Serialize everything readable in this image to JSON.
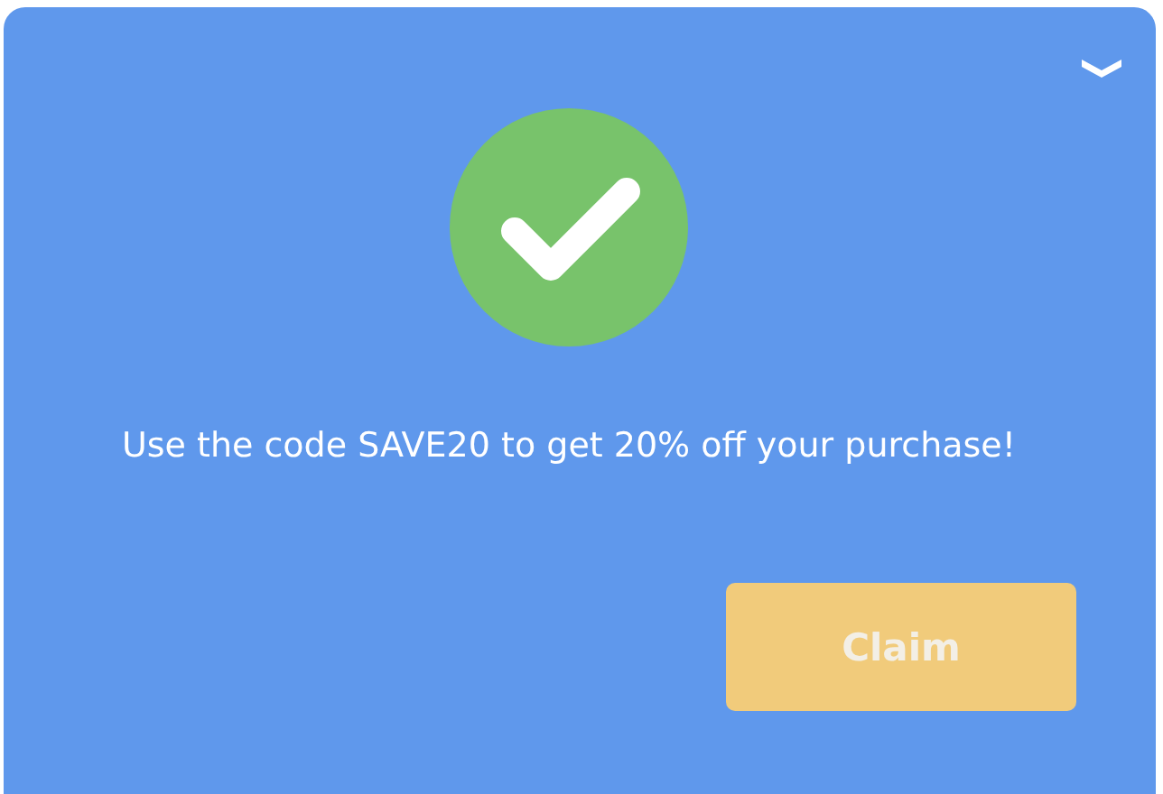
{
  "message": "Use the code SAVE20 to get 20% off your purchase!",
  "button": {
    "label": "Claim"
  }
}
